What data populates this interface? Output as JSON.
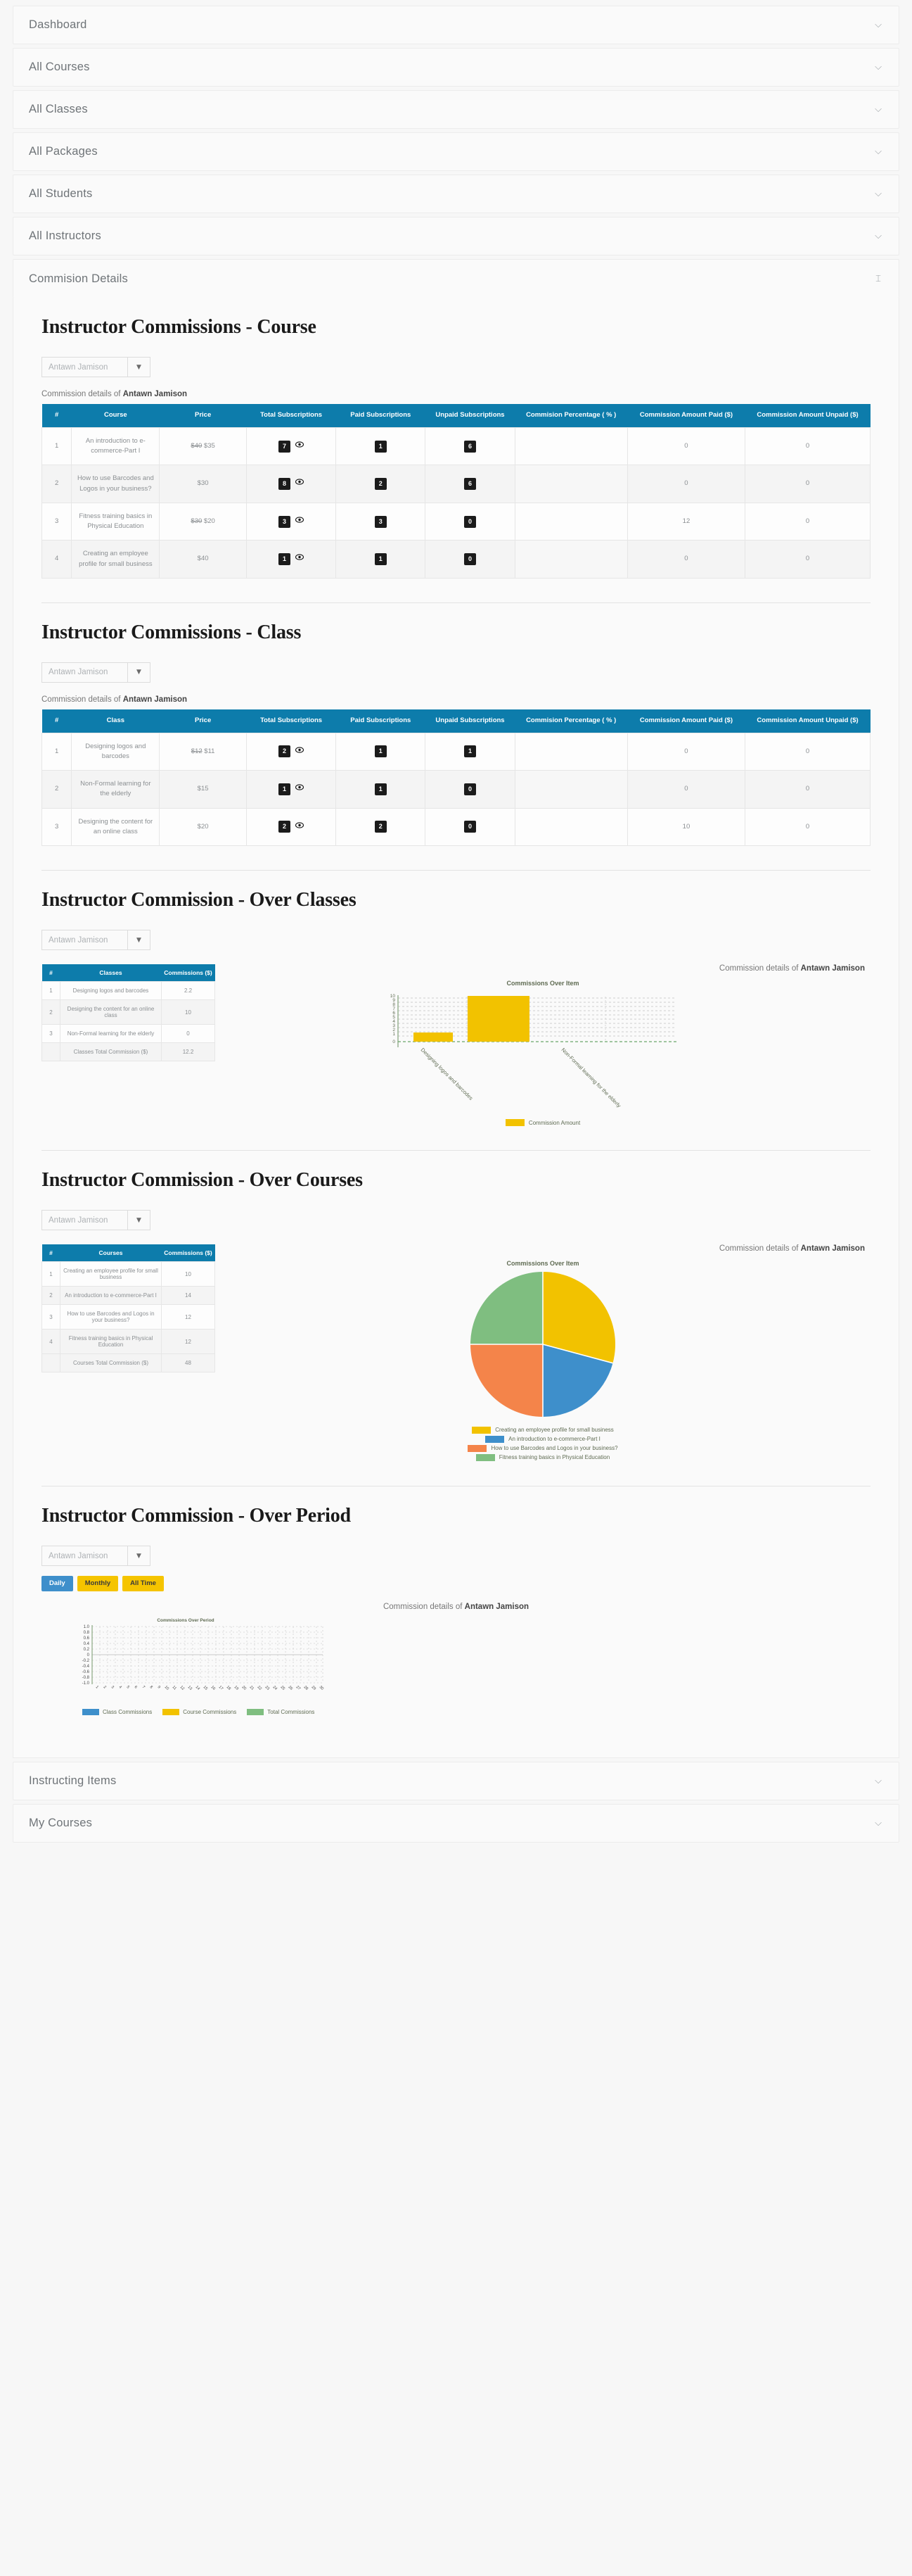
{
  "accordions_top": [
    {
      "label": "Dashboard",
      "state": "collapsed",
      "chevron": "chevron-down"
    },
    {
      "label": "All Courses",
      "state": "collapsed",
      "chevron": "chevron-down"
    },
    {
      "label": "All Classes",
      "state": "collapsed",
      "chevron": "chevron-down"
    },
    {
      "label": "All Packages",
      "state": "collapsed",
      "chevron": "chevron-down"
    },
    {
      "label": "All Students",
      "state": "collapsed",
      "chevron": "chevron-down"
    },
    {
      "label": "All Instructors",
      "state": "collapsed",
      "chevron": "chevron-down"
    },
    {
      "label": "Commision Details",
      "state": "expanded",
      "chevron": "chevron-up"
    }
  ],
  "accordions_bottom": [
    {
      "label": "Instructing Items",
      "state": "collapsed",
      "chevron": "chevron-down"
    },
    {
      "label": "My Courses",
      "state": "collapsed",
      "chevron": "chevron-down"
    }
  ],
  "instructor": "Antawn Jamison",
  "select_placeholder": "Antawn Jamison",
  "detail_prefix": "Commission details of ",
  "colors": {
    "table_header": "#0d7cab",
    "badge": "#1b1b1b",
    "yellow": "#f5c400",
    "blue": "#3e8fcb",
    "orange": "#f4844a",
    "green": "#7fbe80"
  },
  "course_section": {
    "title": "Instructor Commissions - Course",
    "columns": [
      "#",
      "Course",
      "Price",
      "Total Subscriptions",
      "Paid Subscriptions",
      "Unpaid Subscriptions",
      "Commision Percentage ( % )",
      "Commission Amount Paid ($)",
      "Commission Amount Unpaid ($)"
    ],
    "rows": [
      {
        "n": "1",
        "name": "An introduction to e-commerce-Part I",
        "price_old": "$40",
        "price_new": "$35",
        "total": "7",
        "paid": "1",
        "unpaid": "6",
        "pct": "",
        "paid_amt": "0",
        "unpaid_amt": "0"
      },
      {
        "n": "2",
        "name": "How to use Barcodes and Logos in your business?",
        "price_old": "",
        "price_new": "$30",
        "total": "8",
        "paid": "2",
        "unpaid": "6",
        "pct": "",
        "paid_amt": "0",
        "unpaid_amt": "0"
      },
      {
        "n": "3",
        "name": "Fitness training basics in Physical Education",
        "price_old": "$30",
        "price_new": "$20",
        "total": "3",
        "paid": "3",
        "unpaid": "0",
        "pct": "",
        "paid_amt": "12",
        "unpaid_amt": "0"
      },
      {
        "n": "4",
        "name": "Creating an employee profile for small business",
        "price_old": "",
        "price_new": "$40",
        "total": "1",
        "paid": "1",
        "unpaid": "0",
        "pct": "",
        "paid_amt": "0",
        "unpaid_amt": "0"
      }
    ]
  },
  "class_section": {
    "title": "Instructor Commissions - Class",
    "columns": [
      "#",
      "Class",
      "Price",
      "Total Subscriptions",
      "Paid Subscriptions",
      "Unpaid Subscriptions",
      "Commision Percentage ( % )",
      "Commission Amount Paid ($)",
      "Commission Amount Unpaid ($)"
    ],
    "rows": [
      {
        "n": "1",
        "name": "Designing logos and barcodes",
        "price_old": "$12",
        "price_new": "$11",
        "total": "2",
        "paid": "1",
        "unpaid": "1",
        "pct": "",
        "paid_amt": "0",
        "unpaid_amt": "0"
      },
      {
        "n": "2",
        "name": "Non-Formal learning for the elderly",
        "price_old": "",
        "price_new": "$15",
        "total": "1",
        "paid": "1",
        "unpaid": "0",
        "pct": "",
        "paid_amt": "0",
        "unpaid_amt": "0"
      },
      {
        "n": "3",
        "name": "Designing the content for an online class",
        "price_old": "",
        "price_new": "$20",
        "total": "2",
        "paid": "2",
        "unpaid": "0",
        "pct": "",
        "paid_amt": "10",
        "unpaid_amt": "0"
      }
    ]
  },
  "over_classes": {
    "title": "Instructor Commission - Over Classes",
    "columns": [
      "#",
      "Classes",
      "Commissions ($)"
    ],
    "rows": [
      {
        "n": "1",
        "name": "Designing logos and barcodes",
        "value": "2.2"
      },
      {
        "n": "2",
        "name": "Designing the content for an online class",
        "value": "10"
      },
      {
        "n": "3",
        "name": "Non-Formal learning for the elderly",
        "value": "0"
      }
    ],
    "total_label": "Classes Total Commission ($)",
    "total_value": "12.2"
  },
  "over_courses": {
    "title": "Instructor Commission - Over Courses",
    "columns": [
      "#",
      "Courses",
      "Commissions ($)"
    ],
    "rows": [
      {
        "n": "1",
        "name": "Creating an employee profile for small business",
        "value": "10"
      },
      {
        "n": "2",
        "name": "An introduction to e-commerce-Part I",
        "value": "14"
      },
      {
        "n": "3",
        "name": "How to use Barcodes and Logos in your business?",
        "value": "12"
      },
      {
        "n": "4",
        "name": "Fitness training basics in Physical Education",
        "value": "12"
      }
    ],
    "total_label": "Courses Total Commission ($)",
    "total_value": "48"
  },
  "over_period": {
    "title": "Instructor Commission - Over Period",
    "buttons": [
      {
        "label": "Daily",
        "active": true,
        "style": "blue"
      },
      {
        "label": "Monthly",
        "active": false,
        "style": "yellow"
      },
      {
        "label": "All Time",
        "active": false,
        "style": "yellow"
      }
    ]
  },
  "chart_data": [
    {
      "type": "bar",
      "id": "over-classes-bar",
      "title": "Commissions Over Item",
      "categories": [
        "Designing logos and barcodes",
        "Non-Formal learning for the elderly"
      ],
      "values": [
        2.2,
        0
      ],
      "series": [
        {
          "name": "Commission Amount",
          "values": [
            2.2,
            0
          ]
        }
      ],
      "hidden_bar_value": 10,
      "ylim": [
        0,
        10
      ],
      "yticks": [
        0,
        1,
        2,
        3,
        4,
        5,
        6,
        7,
        8,
        9,
        10
      ],
      "ylabel": "",
      "xlabel": "",
      "grid": true,
      "legend": [
        "Commission Amount"
      ],
      "legend_position": "bottom",
      "bar_color": "#f5c400"
    },
    {
      "type": "pie",
      "id": "over-courses-pie",
      "title": "Commissions Over Item",
      "labels": [
        "Creating an employee profile for small business",
        "An introduction to e-commerce-Part I",
        "How to use Barcodes and Logos in your business?",
        "Fitness training basics in Physical Education"
      ],
      "values": [
        10,
        14,
        12,
        12
      ],
      "colors": [
        "#f5c400",
        "#3e8fcb",
        "#f4844a",
        "#7fbe80"
      ],
      "legend_position": "bottom"
    },
    {
      "type": "line",
      "id": "over-period-line",
      "title": "Commissions Over Period",
      "x": [
        "1",
        "2",
        "3",
        "4",
        "5",
        "6",
        "7",
        "8",
        "9",
        "10",
        "11",
        "12",
        "13",
        "14",
        "15",
        "16",
        "17",
        "18",
        "19",
        "20",
        "21",
        "22",
        "23",
        "24",
        "25",
        "26",
        "27",
        "28",
        "29",
        "30"
      ],
      "series": [
        {
          "name": "Class Commissions",
          "values": [],
          "color": "#3e8fcb"
        },
        {
          "name": "Course Commissions",
          "values": [],
          "color": "#f5c400"
        },
        {
          "name": "Total Commissions",
          "values": [],
          "color": "#7fbe80"
        }
      ],
      "ylim": [
        -1.0,
        1.0
      ],
      "yticks": [
        "1.0",
        "0.8",
        "0.6",
        "0.4",
        "0.2",
        "0",
        "-0.2",
        "-0.4",
        "-0.6",
        "-0.8",
        "-1.0"
      ],
      "grid": true,
      "legend_position": "bottom"
    }
  ]
}
